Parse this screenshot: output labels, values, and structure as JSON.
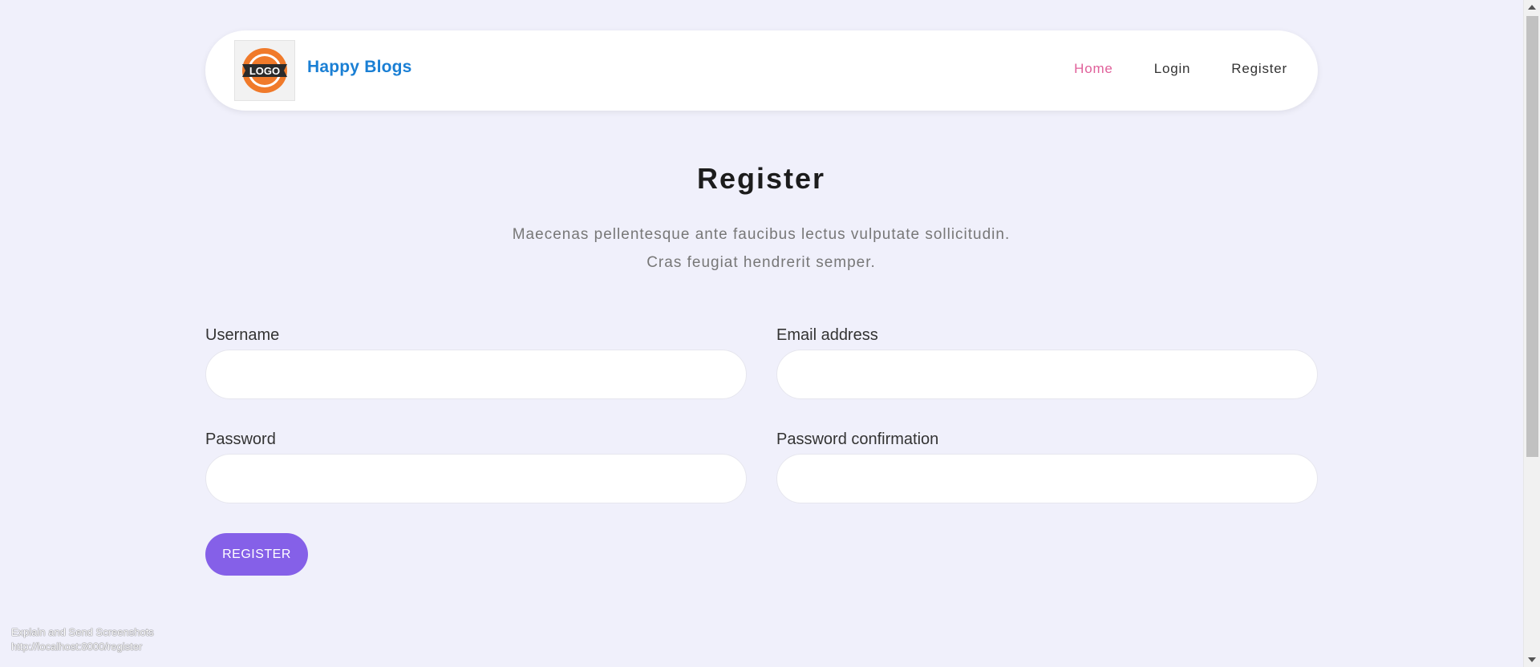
{
  "navbar": {
    "logo_text": "LOGO",
    "brand": "Happy Blogs",
    "links": [
      {
        "label": "Home",
        "active": true
      },
      {
        "label": "Login",
        "active": false
      },
      {
        "label": "Register",
        "active": false
      }
    ]
  },
  "heading": {
    "title": "Register",
    "subtitle_line1": "Maecenas pellentesque ante faucibus lectus vulputate sollicitudin.",
    "subtitle_line2": "Cras feugiat hendrerit semper."
  },
  "form": {
    "username_label": "Username",
    "username_value": "",
    "email_label": "Email address",
    "email_value": "",
    "password_label": "Password",
    "password_value": "",
    "password_confirmation_label": "Password confirmation",
    "password_confirmation_value": "",
    "submit_label": "REGISTER"
  },
  "overlay": {
    "line1": "Explain and Send Screenshots",
    "line2": "http://localhost:8000/register"
  },
  "colors": {
    "background": "#f0f0fb",
    "brand": "#1a7fd4",
    "active_link": "#e0609a",
    "button": "#8560e8"
  }
}
